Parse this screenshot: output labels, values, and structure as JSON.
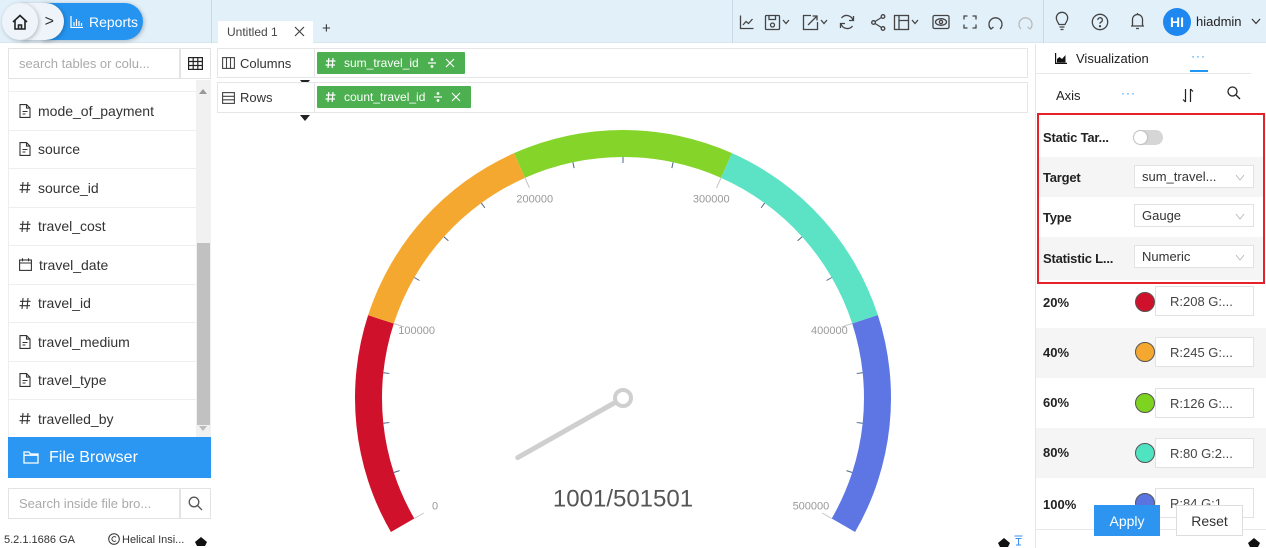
{
  "header": {
    "breadcrumb": {
      "home_icon": "home-icon",
      "separator": ">",
      "current": "Reports",
      "current_icon": "bar-chart-icon"
    },
    "tabs": [
      {
        "label": "Untitled 1",
        "active": true
      }
    ],
    "add_tab": "+",
    "toolbar": [
      {
        "icon": "line-chart-icon",
        "dropdown": false
      },
      {
        "icon": "save-icon",
        "dropdown": true
      },
      {
        "icon": "export-icon",
        "dropdown": true
      },
      {
        "icon": "refresh-icon",
        "dropdown": false
      },
      {
        "icon": "share-icon",
        "dropdown": false
      },
      {
        "icon": "layout-icon",
        "dropdown": true
      },
      {
        "icon": "preview-eye-icon",
        "dropdown": false
      },
      {
        "icon": "fullscreen-icon",
        "dropdown": false
      },
      {
        "icon": "undo-icon",
        "dropdown": false
      },
      {
        "icon": "redo-icon",
        "dropdown": false,
        "disabled": true
      }
    ],
    "right_icons": [
      "lightbulb-icon",
      "help-icon",
      "bell-icon"
    ],
    "user": {
      "initials": "HI",
      "name": "hiadmin",
      "avatar_color": "#1e88f0"
    }
  },
  "sidebar": {
    "search_placeholder": "search tables or colu...",
    "fields": [
      {
        "type": "text",
        "name": "mode_of_payment"
      },
      {
        "type": "text",
        "name": "source"
      },
      {
        "type": "number",
        "name": "source_id"
      },
      {
        "type": "number",
        "name": "travel_cost"
      },
      {
        "type": "date",
        "name": "travel_date"
      },
      {
        "type": "number",
        "name": "travel_id"
      },
      {
        "type": "text",
        "name": "travel_medium"
      },
      {
        "type": "text",
        "name": "travel_type"
      },
      {
        "type": "number",
        "name": "travelled_by"
      }
    ],
    "file_browser_label": "File Browser",
    "file_search_placeholder": "Search inside file bro...",
    "version": "5.2.1.1686 GA",
    "copyright": "Helical Insi..."
  },
  "shelves": {
    "columns": {
      "label": "Columns",
      "chips": [
        {
          "name": "sum_travel_id"
        }
      ]
    },
    "rows": {
      "label": "Rows",
      "chips": [
        {
          "name": "count_travel_id"
        }
      ]
    },
    "chip_color": "#4caf50"
  },
  "panel": {
    "tabs": [
      {
        "label": "Visualization"
      },
      {
        "label": "···",
        "active": true
      }
    ],
    "axis_label": "Axis",
    "axis_more": "···",
    "settings": [
      {
        "label": "Static Tar...",
        "type": "toggle",
        "value": false
      },
      {
        "label": "Target",
        "type": "select",
        "value": "sum_travel..."
      },
      {
        "label": "Type",
        "type": "select",
        "value": "Gauge"
      },
      {
        "label": "Statistic L...",
        "type": "select",
        "value": "Numeric"
      }
    ],
    "color_stops": [
      {
        "label": "20%",
        "color": "#d0112b",
        "text": "R:208 G:..."
      },
      {
        "label": "40%",
        "color": "#f5a82f",
        "text": "R:245 G:..."
      },
      {
        "label": "60%",
        "color": "#7ed321",
        "text": "R:126 G:..."
      },
      {
        "label": "80%",
        "color": "#50e3c2",
        "text": "R:80 G:2..."
      },
      {
        "label": "100%",
        "color": "#5a74e0",
        "text": "R:84 G:1"
      }
    ],
    "apply_label": "Apply",
    "reset_label": "Reset",
    "highlight_color": "#e8202a"
  },
  "chart_data": {
    "type": "gauge",
    "min": 0,
    "max": 500000,
    "value": 1001,
    "target": 501501,
    "display_label": "1001/501501",
    "split_number": 5,
    "minor_ticks_per_split": 4,
    "axis_labels": [
      "0",
      "100000",
      "200000",
      "300000",
      "400000",
      "500000"
    ],
    "bands": [
      {
        "to": 0.2,
        "color": "#d0112b"
      },
      {
        "to": 0.4,
        "color": "#f5a82f"
      },
      {
        "to": 0.6,
        "color": "#84d42a"
      },
      {
        "to": 0.8,
        "color": "#5ce3c6"
      },
      {
        "to": 1.0,
        "color": "#5d76e3"
      }
    ],
    "title": "",
    "legend": "none"
  }
}
